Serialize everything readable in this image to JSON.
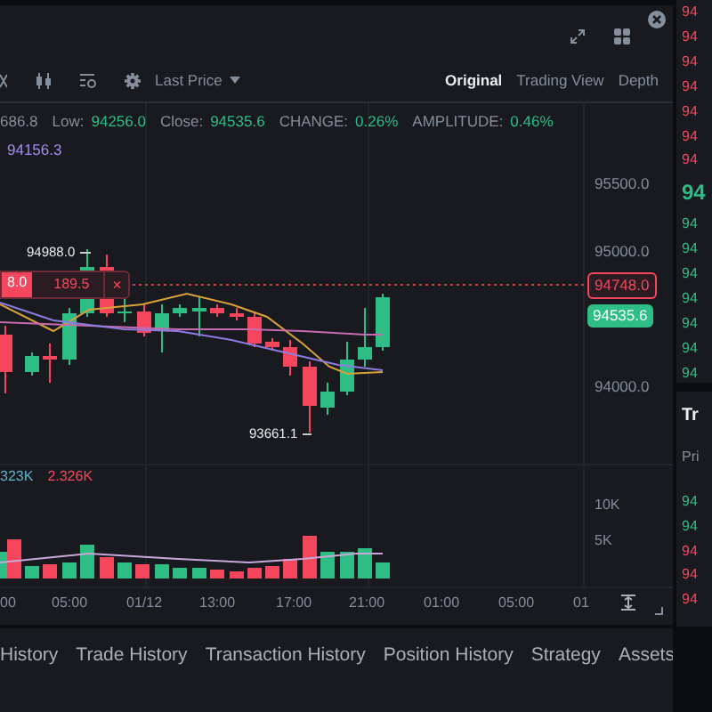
{
  "toolbar": {
    "price_type": "Last Price",
    "views": [
      {
        "label": "Original",
        "selected": true
      },
      {
        "label": "Trading View",
        "selected": false
      },
      {
        "label": "Depth",
        "selected": false
      }
    ]
  },
  "stats": {
    "partial_value": "686.8",
    "items": [
      {
        "label": "Low:",
        "value": "94256.0"
      },
      {
        "label": "Close:",
        "value": "94535.6"
      },
      {
        "label": "CHANGE:",
        "value": "0.26%"
      },
      {
        "label": "AMPLITUDE:",
        "value": "0.46%"
      }
    ]
  },
  "ma_value": "94156.3",
  "y_axis": [
    "95500.0",
    "95000.0",
    "94000.0"
  ],
  "high_marker": "94988.0",
  "low_marker": "93661.1",
  "order_line": {
    "price": "8.0",
    "quantity": "189.5",
    "close": "×"
  },
  "price_tags": [
    {
      "text": "94748.0",
      "kind": "order"
    },
    {
      "text": "94535.6",
      "kind": "last"
    }
  ],
  "volume": {
    "values": [
      {
        "text": "323K",
        "color": "#5fb4c9"
      },
      {
        "text": "2.326K",
        "color": "#f6465d"
      }
    ],
    "axis": [
      "10K",
      "5K"
    ]
  },
  "x_axis": [
    "00",
    "05:00",
    "01/12",
    "13:00",
    "17:00",
    "21:00",
    "01:00",
    "05:00",
    "01"
  ],
  "bottom_tabs": [
    "History",
    "Trade History",
    "Transaction History",
    "Position History",
    "Strategy",
    "Assets"
  ],
  "order_book": {
    "asks": [
      "94",
      "94",
      "94",
      "94",
      "94",
      "94",
      "94"
    ],
    "last": "94",
    "bids": [
      "94",
      "94",
      "94",
      "94",
      "94",
      "94",
      "94"
    ]
  },
  "trades": {
    "title": "Tr",
    "header": "Pri",
    "rows": [
      {
        "text": "94",
        "color": "#2ebd85"
      },
      {
        "text": "94",
        "color": "#2ebd85"
      },
      {
        "text": "94",
        "color": "#f6465d"
      },
      {
        "text": "94",
        "color": "#f6465d"
      },
      {
        "text": "94",
        "color": "#f6465d"
      }
    ]
  }
}
